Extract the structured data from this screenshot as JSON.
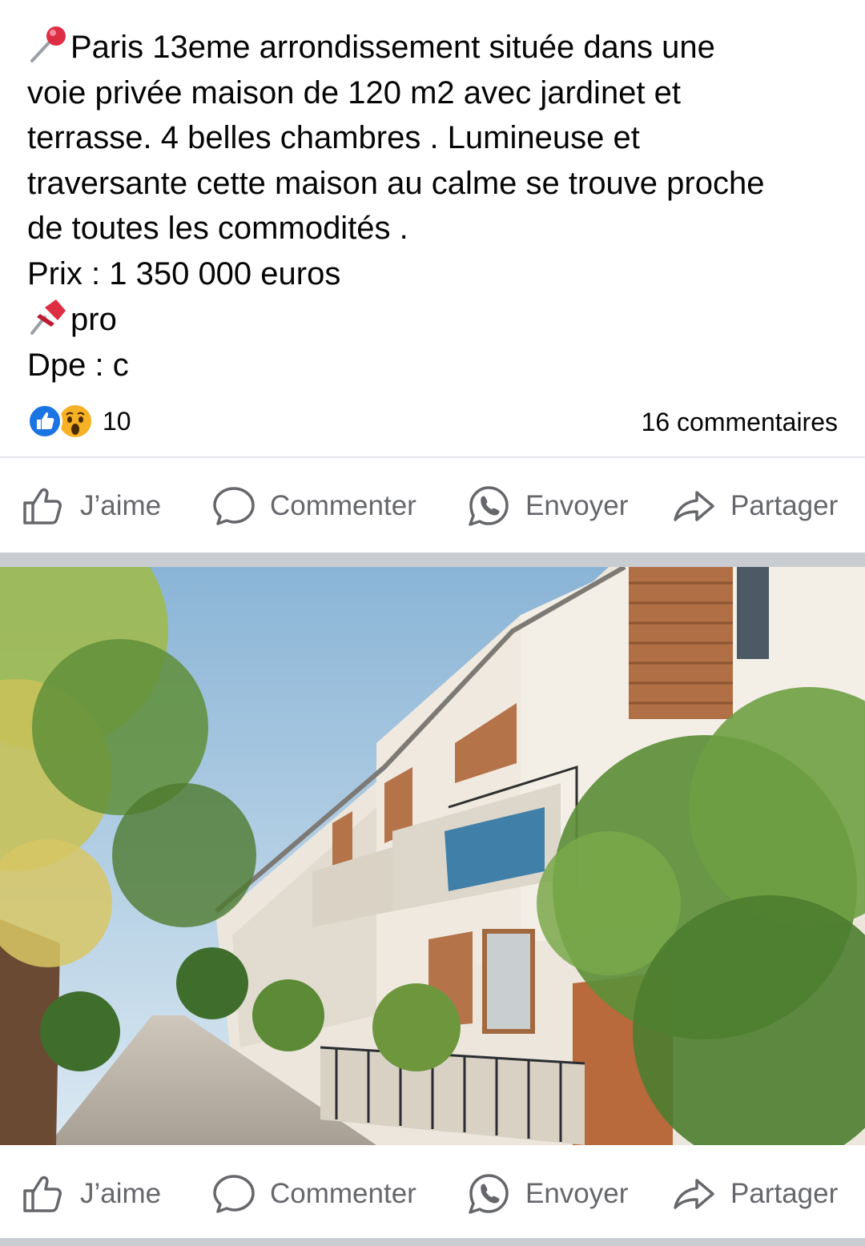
{
  "post": {
    "lines": [
      "Paris 13eme arrondissement située dans une",
      "voie privée maison de 120 m2 avec jardinet et",
      "terrasse. 4 belles chambres . Lumineuse et",
      "traversante cette maison au calme se trouve proche",
      "de toutes les commodités .",
      "Prix : 1 350 000 euros",
      "pro",
      "Dpe : c"
    ],
    "icons": [
      "round-pushpin-emoji",
      "pushpin-emoji"
    ]
  },
  "stats": {
    "reaction_count": "10",
    "comments": "16 commentaires",
    "reaction_icons": [
      "like-reaction-icon",
      "wow-reaction-icon"
    ]
  },
  "actions": {
    "like": "J’aime",
    "comment": "Commenter",
    "send": "Envoyer",
    "share": "Partager"
  },
  "colors": {
    "like_blue": "#1b74e4",
    "action_grey": "#65676b",
    "separator": "#c9ccd1"
  }
}
